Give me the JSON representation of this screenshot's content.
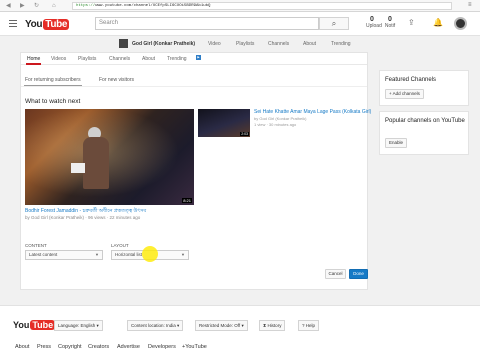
{
  "browser": {
    "url": "https://www.youtube.com/channel/UCEfpSLI6CXOi5BDR9Ab1ubQ",
    "url_scheme": "https://",
    "url_rest": "www.youtube.com/channel/UCEfpSLI6CXOi5BDR9Ab1ubQ",
    "menu_glyph": "≡"
  },
  "masthead": {
    "logo_you": "You",
    "logo_tube": "Tube",
    "search_placeholder": "Search",
    "upload_count": "0",
    "upload_label": "Upload",
    "notif_count": "0",
    "notif_label": "Notif"
  },
  "channel_nav": {
    "channel_name": "God Girl (Konkar Pratheik)",
    "items": [
      "Video",
      "Playlists",
      "Channels",
      "About",
      "Trending"
    ]
  },
  "tabs": [
    "Home",
    "Videos",
    "Playlists",
    "Channels",
    "About",
    "Trending"
  ],
  "subtabs": [
    "For returning subscribers",
    "For new visitors"
  ],
  "section_title": "What to watch next",
  "featured_video": {
    "duration": "8:21",
    "title": "Bodhir Forest Jamaddin - চক্রবর্তী অধীনে প্রত্নতত্ত্ব উৎসব",
    "meta": "by God Girl (Konkar Pratheik) · 96 views · 22 minutes ago"
  },
  "side_video": {
    "duration": "2:03",
    "title": "Sei Hate Khatte Amar Maya Lage Pass (Kolkata Girl)",
    "channel": "by God Girl (Konkar Pratheik)",
    "meta": "1 view · 30 minutes ago"
  },
  "settings": {
    "content_label": "CONTENT",
    "content_value": "Latest content",
    "layout_label": "LAYOUT",
    "layout_value": "Horizontal list",
    "cancel": "Cancel",
    "done": "Done"
  },
  "sidebar": {
    "featured_title": "Featured Channels",
    "add_channels": "+ Add channels",
    "popular_title": "Popular channels on YouTube",
    "enable": "Enable"
  },
  "footer": {
    "language": "Language: English",
    "location": "Content location: India",
    "restricted": "Restricted Mode: Off",
    "history": "History",
    "help": "Help",
    "links": [
      "About",
      "Press",
      "Copyright",
      "Creators",
      "Advertise",
      "Developers",
      "+YouTube"
    ]
  }
}
